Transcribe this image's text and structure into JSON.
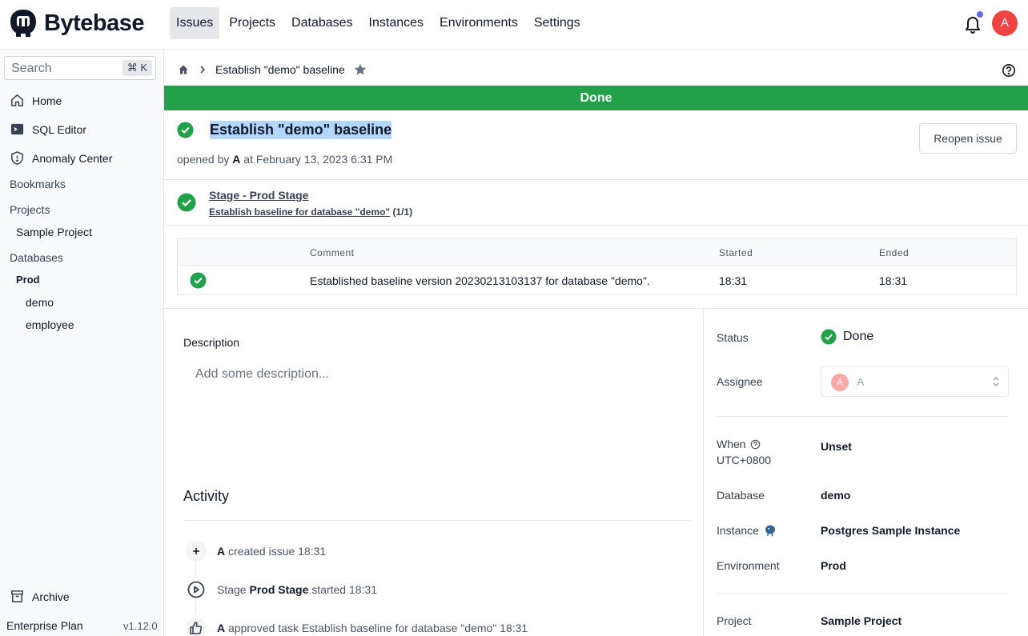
{
  "app": {
    "name": "Bytebase",
    "nav": [
      "Issues",
      "Projects",
      "Databases",
      "Instances",
      "Environments",
      "Settings"
    ],
    "user_initial": "A"
  },
  "sidebar": {
    "search_placeholder": "Search",
    "search_shortcut": "⌘ K",
    "items": [
      {
        "label": "Home",
        "icon": "home-icon"
      },
      {
        "label": "SQL Editor",
        "icon": "terminal-icon"
      },
      {
        "label": "Anomaly Center",
        "icon": "shield-icon"
      }
    ],
    "bookmarks_label": "Bookmarks",
    "projects_label": "Projects",
    "projects": [
      "Sample Project"
    ],
    "databases_label": "Databases",
    "environment": "Prod",
    "databases": [
      "demo",
      "employee"
    ],
    "archive_label": "Archive",
    "plan": "Enterprise Plan",
    "version": "v1.12.0"
  },
  "breadcrumb": {
    "title": "Establish \"demo\" baseline"
  },
  "issue": {
    "banner": "Done",
    "title": "Establish \"demo\" baseline",
    "opened_prefix": "opened by ",
    "opened_by": "A",
    "opened_suffix": " at February 13, 2023 6:31 PM",
    "reopen_label": "Reopen issue",
    "stage_name": "Stage - Prod Stage",
    "stage_task": "Establish baseline for database \"demo\"",
    "stage_count": "(1/1)"
  },
  "task_table": {
    "headers": {
      "comment": "Comment",
      "started": "Started",
      "ended": "Ended"
    },
    "row": {
      "comment": "Established baseline version 20230213103137 for database \"demo\".",
      "started": "18:31",
      "ended": "18:31"
    }
  },
  "description": {
    "label": "Description",
    "placeholder": "Add some description..."
  },
  "activity": {
    "title": "Activity",
    "items": [
      {
        "actor": "A",
        "text": " created issue 18:31"
      },
      {
        "prefix": "Stage ",
        "bold": "Prod Stage",
        "text": " started 18:31"
      },
      {
        "actor": "A",
        "text": " approved task Establish baseline for database \"demo\" 18:31"
      }
    ]
  },
  "details": {
    "status_label": "Status",
    "status_value": "Done",
    "assignee_label": "Assignee",
    "assignee_initial": "A",
    "assignee_name": "A",
    "when_label": "When",
    "when_tz": "UTC+0800",
    "when_value": "Unset",
    "database_label": "Database",
    "database_value": "demo",
    "instance_label": "Instance",
    "instance_value": "Postgres Sample Instance",
    "environment_label": "Environment",
    "environment_value": "Prod",
    "project_label": "Project",
    "project_value": "Sample Project"
  },
  "colors": {
    "success": "#22a04a",
    "accent": "#6366f1",
    "avatar": "#ef4444"
  }
}
